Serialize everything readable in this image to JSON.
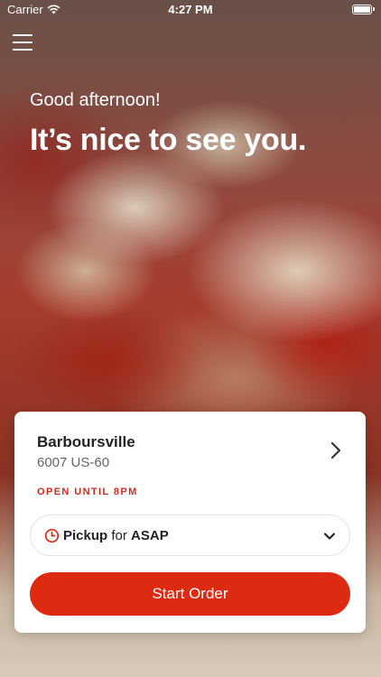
{
  "status_bar": {
    "carrier": "Carrier",
    "time": "4:27 PM"
  },
  "hero": {
    "greeting": "Good afternoon!",
    "headline": "It’s nice to see you."
  },
  "store": {
    "name": "Barboursville",
    "address": "6007 US-60",
    "hours": "OPEN UNTIL 8PM"
  },
  "order": {
    "mode": "Pickup",
    "connector": "for",
    "time": "ASAP",
    "start_label": "Start Order"
  },
  "colors": {
    "accent": "#df2a12",
    "hours_text": "#d32a1a"
  },
  "icons": {
    "menu": "hamburger-menu-icon",
    "wifi": "wifi-icon",
    "battery": "battery-icon",
    "clock": "clock-icon",
    "chevron_right": "chevron-right-icon",
    "dropdown": "chevron-down-icon"
  }
}
